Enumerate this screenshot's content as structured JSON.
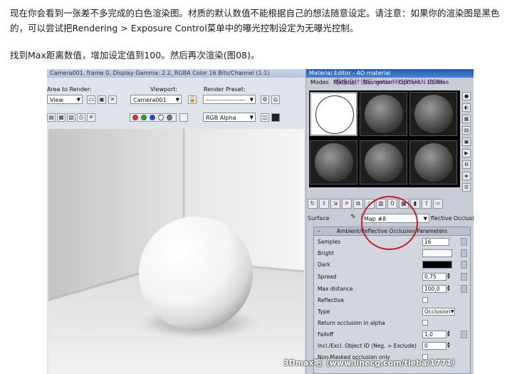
{
  "article": {
    "p1": "现在你会看到一张差不多完成的白色渲染图。材质的默认数值不能根据自己的想法随意设定。请注意：如果你的渲染图是黑色的，可以尝试把Rendering > Exposure Control菜单中的曝光控制设定为无曝光控制。",
    "p2": "找到Max距离数值，增加设定值到100。然后再次渲染(图08)。"
  },
  "render_window": {
    "title": "Camera001, frame 0, Display Gamma: 2.2, RGBA Color 16 Bits/Channel (1:1)",
    "area_label": "Area to Render:",
    "area_value": "View",
    "viewport_label": "Viewport:",
    "viewport_value": "Camera001",
    "preset_label": "Render Preset:",
    "preset_value": "-------------------",
    "channel_value": "RGB Alpha"
  },
  "material_editor": {
    "title": "Material Editor - AO material",
    "menu": [
      "Modes",
      "Material",
      "Navigation",
      "Options",
      "Utilities"
    ],
    "surface_label": "Surface",
    "map_value": "Map #8",
    "map_tail": "flective Occlusion",
    "rollout_title": "Ambient/Reflective Occlusion Parameters",
    "params": {
      "samples_label": "Samples",
      "samples_value": "16",
      "bright_label": "Bright",
      "dark_label": "Dark",
      "spread_label": "Spread",
      "spread_value": "0,75",
      "max_distance_label": "Max distance",
      "max_distance_value": "100,0",
      "reflective_label": "Reflective",
      "type_label": "Type",
      "type_value": "Occlusion",
      "return_alpha_label": "Return occlusion in alpha",
      "falloff_label": "Falloff",
      "falloff_value": "1,0",
      "incl_label": "Incl./Excl. Object ID (Neg. = Exclude)",
      "incl_value": "0",
      "nonmask_label": "Non-Masked occlusion only"
    },
    "colors": {
      "bright": "#ffffff",
      "dark": "#000000"
    }
  },
  "watermarks": {
    "site_top": "思缘设计论坛 www.MISSYUAN.COM",
    "site_bottom": "3Dmax吧（www.linecg.com/tieba/1771）"
  },
  "annotation": {
    "highlight_color": "#c01f25"
  }
}
